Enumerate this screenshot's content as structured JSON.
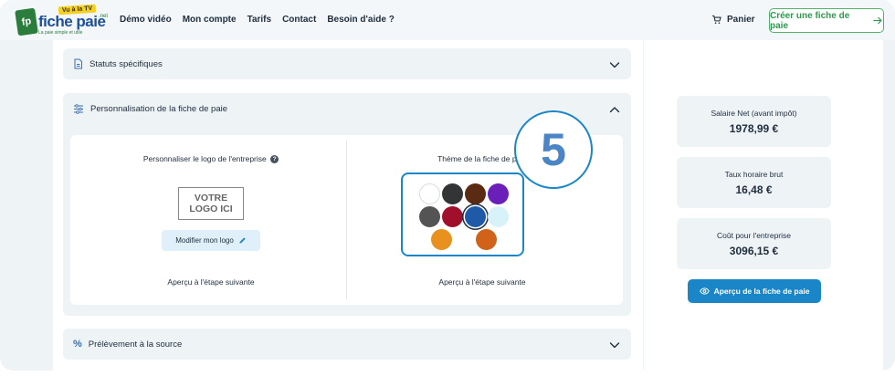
{
  "header": {
    "logo_name": "fiche paie",
    "logo_tv_badge": "Vu à la TV",
    "logo_net": ".net",
    "logo_tagline": "La paie simple et utile",
    "nav": [
      "Démo vidéo",
      "Mon compte",
      "Tarifs",
      "Contact",
      "Besoin d'aide ?"
    ],
    "cart_label": "Panier",
    "cta_label": "Créer une fiche de paie"
  },
  "sections": {
    "statuts": {
      "title": "Statuts spécifiques"
    },
    "personnalisation": {
      "title": "Personnalisation de la fiche de paie",
      "logo_col": {
        "title": "Personnaliser le logo de l'entreprise",
        "help": "?",
        "placeholder_line1": "VOTRE",
        "placeholder_line2": "LOGO ICI",
        "modify_label": "Modifier mon logo",
        "preview": "Aperçu à l'étape suivante"
      },
      "theme_col": {
        "title": "Thème de la fiche de paie",
        "preview": "Aperçu à l'étape suivante",
        "swatches": [
          "#ffffff",
          "#323436",
          "#5a2a12",
          "#6a1fb8",
          "#545454",
          "#a0102a",
          "#1e5aa8",
          "#d8f2fa",
          "#e8911e",
          "#d0621a"
        ],
        "selected_index": 6
      }
    },
    "prelevement": {
      "title": "Prélèvement à la source"
    }
  },
  "badge_number": "5",
  "summary": [
    {
      "label": "Salaire Net (avant impôt)",
      "value": "1978,99 €"
    },
    {
      "label": "Taux horaire brut",
      "value": "16,48 €"
    },
    {
      "label": "Coût pour l'entreprise",
      "value": "3096,15 €"
    }
  ],
  "preview_button": "Aperçu de la fiche de paie",
  "colors": {
    "accent_blue": "#1a86c8",
    "accent_green": "#2e9a4f",
    "panel_bg": "#eef3f6"
  }
}
